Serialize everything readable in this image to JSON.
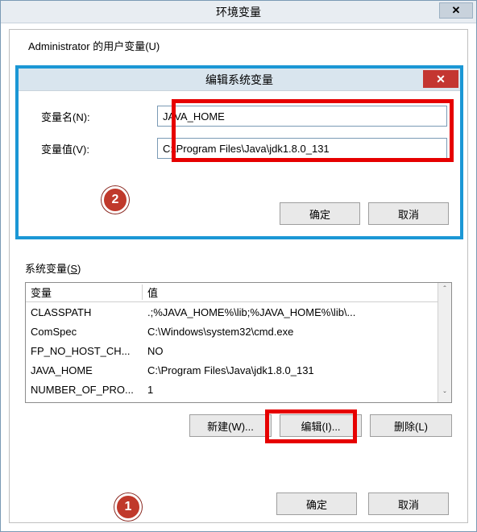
{
  "outer": {
    "title": "环境变量",
    "close_glyph": "✕",
    "truncated_heading": "Administrator 的用户变量(U)"
  },
  "modal": {
    "title": "编辑系统变量",
    "close_glyph": "✕",
    "name_label": "变量名(N):",
    "value_label": "变量值(V):",
    "name_value": "JAVA_HOME",
    "value_value": "C:\\Program Files\\Java\\jdk1.8.0_131",
    "ok_label": "确定",
    "cancel_label": "取消"
  },
  "callouts": {
    "one": "1",
    "two": "2"
  },
  "sysvars": {
    "label_prefix": "系统变量(",
    "label_underline": "S",
    "label_suffix": ")",
    "header_var": "变量",
    "header_val": "值",
    "rows": [
      {
        "var": "CLASSPATH",
        "val": ".;%JAVA_HOME%\\lib;%JAVA_HOME%\\lib\\..."
      },
      {
        "var": "ComSpec",
        "val": "C:\\Windows\\system32\\cmd.exe"
      },
      {
        "var": "FP_NO_HOST_CH...",
        "val": "NO"
      },
      {
        "var": "JAVA_HOME",
        "val": "C:\\Program Files\\Java\\jdk1.8.0_131"
      },
      {
        "var": "NUMBER_OF_PRO...",
        "val": "1"
      }
    ],
    "scroll_up": "ˆ",
    "scroll_down": "ˇ",
    "new_label": "新建(W)...",
    "edit_label": "编辑(I)...",
    "delete_label": "删除(L)"
  },
  "bottom": {
    "ok_label": "确定",
    "cancel_label": "取消"
  }
}
